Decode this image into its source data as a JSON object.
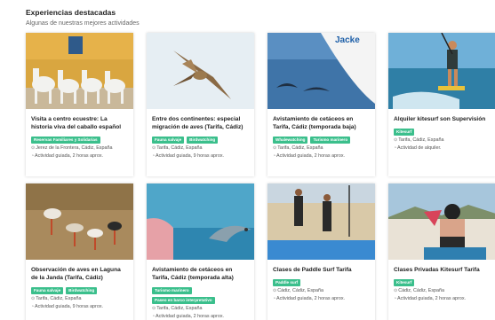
{
  "section": {
    "title": "Experiencias destacadas",
    "subtitle": "Algunas de nuestras mejores actividades"
  },
  "cards": [
    {
      "title": "Visita a centro ecuestre: La historia viva del caballo español",
      "tags": [
        "Reservas Familiares y Solidarias"
      ],
      "location": "Jerez de la Frontera, Cádiz, España",
      "activity": "Actividad guiada, 2 horas aprox.",
      "image": "horses-photo"
    },
    {
      "title": "Entre dos continentes: especial migración de aves (Tarifa, Cádiz)",
      "tags": [
        "Fauna salvaje",
        "Birdwatching"
      ],
      "location": "Tarifa, Cádiz, España",
      "activity": "Actividad guiada, 9 horas aprox.",
      "image": "bird-of-prey-photo"
    },
    {
      "title": "Avistamiento de cetáceos en Tarifa, Cádiz (temporada baja)",
      "tags": [
        "Whalewatching",
        "Turismo marinero"
      ],
      "location": "Tarifa, Cádiz, España",
      "activity": "Actividad guiada, 2 horas aprox.",
      "image": "dolphins-boat-photo",
      "boat_text": "Jacke"
    },
    {
      "title": "Alquiler kitesurf son Supervisión",
      "tags": [
        "Kitesurf"
      ],
      "location": "Tarifa, Cádiz, España",
      "activity": "Actividad de alquiler.",
      "image": "kitesurf-photo"
    },
    {
      "title": "Observación de aves en Laguna de la Janda (Tarifa, Cádiz)",
      "tags": [
        "Fauna salvaje",
        "Birdwatching"
      ],
      "location": "Tarifa, Cádiz, España",
      "activity": "Actividad guiada, 9 horas aprox.",
      "image": "storks-photo"
    },
    {
      "title": "Avistamiento de cetáceos en Tarifa, Cádiz (temporada alta)",
      "tags": [
        "Turismo marinero",
        "Paseo en barco interpretativo"
      ],
      "location": "Tarifa, Cádiz, España",
      "activity": "Actividad guiada, 2 horas aprox.",
      "image": "dolphin-photo"
    },
    {
      "title": "Clases de Paddle Surf Tarifa",
      "tags": [
        "Paddle surf"
      ],
      "location": "Cádiz, Cádiz, España",
      "activity": "Actividad guiada, 2 horas aprox.",
      "image": "paddle-surf-photo"
    },
    {
      "title": "Clases Privadas Kitesurf Tarifa",
      "tags": [
        "Kitesurf"
      ],
      "location": "Cádiz, Cádiz, España",
      "activity": "Actividad guiada, 2 horas aprox.",
      "image": "kitesurf-lesson-photo"
    }
  ],
  "icons": {
    "location": "pin-icon",
    "activity": "clock-icon"
  },
  "colors": {
    "tag": "#3bbf8c"
  }
}
